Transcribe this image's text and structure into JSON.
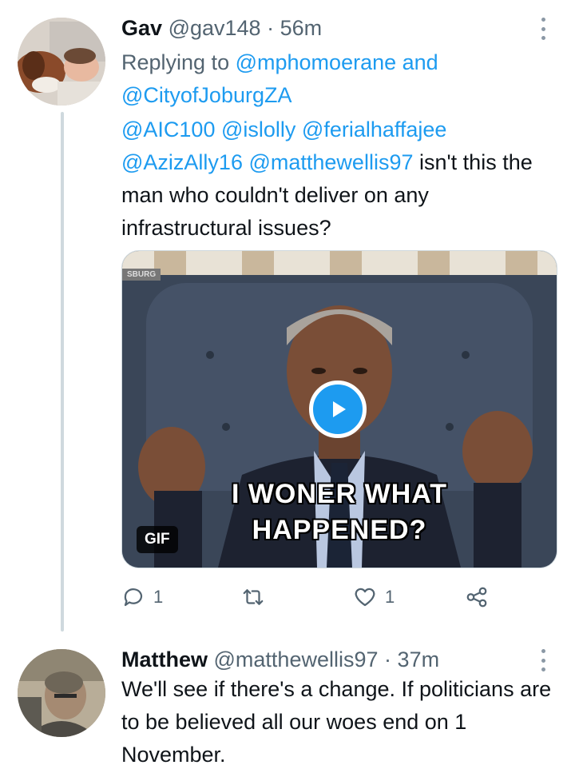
{
  "tweet1": {
    "display_name": "Gav",
    "handle": "@gav148",
    "separator": "·",
    "time": "56m",
    "replying_prefix": "Replying to",
    "replying_to_1": "@mphomoerane",
    "replying_and": "and",
    "replying_to_2": "@CityofJoburgZA",
    "mentions": [
      "@AIC100",
      "@islolly",
      "@ferialhaffajee",
      "@AzizAlly16",
      "@matthewellis97"
    ],
    "text_after_mentions": "isn't this the man who couldn't deliver on any infrastructural issues?",
    "media": {
      "caption_line1": "I WONER WHAT",
      "caption_line2": "HAPPENED?",
      "badge": "GIF",
      "watermark": "SBURG",
      "play_icon": "play-icon"
    },
    "actions": {
      "reply_count": "1",
      "retweet_count": "",
      "like_count": "1"
    }
  },
  "tweet2": {
    "display_name": "Matthew",
    "handle": "@matthewellis97",
    "separator": "·",
    "time": "37m",
    "text": "We'll see if there's a change. If politicians are to be believed all our woes end on 1 November."
  },
  "colors": {
    "link": "#1d9bf0",
    "secondary_text": "#536471",
    "primary_text": "#0f1419",
    "thread_line": "#cfd9de"
  }
}
